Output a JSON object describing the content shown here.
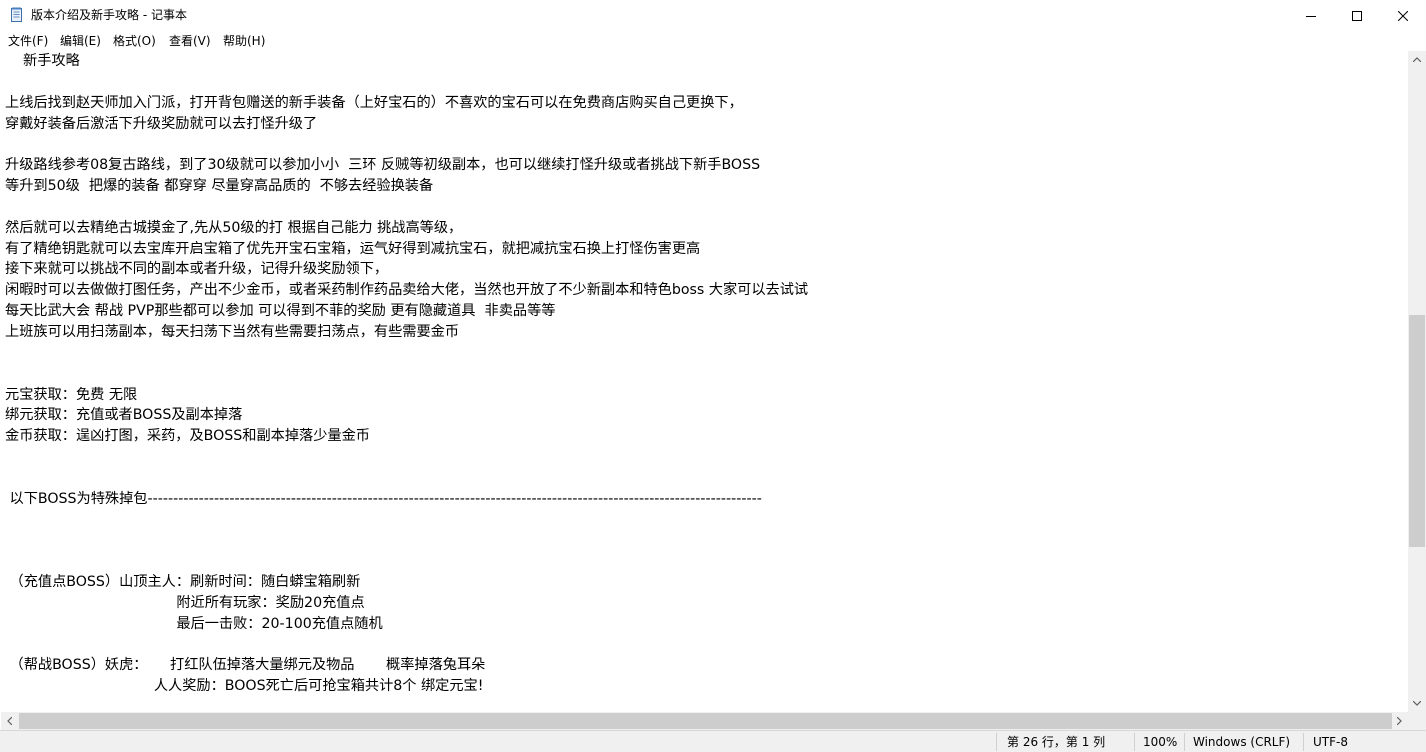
{
  "window": {
    "title": "版本介绍及新手攻略 - 记事本",
    "icon": "notepad-icon"
  },
  "menu": [
    {
      "label": "文件(F)"
    },
    {
      "label": "编辑(E)"
    },
    {
      "label": "格式(O)"
    },
    {
      "label": "查看(V)"
    },
    {
      "label": "帮助(H)"
    }
  ],
  "document": {
    "lines": [
      "    新手攻略",
      "",
      "上线后找到赵天师加入门派，打开背包赠送的新手装备（上好宝石的）不喜欢的宝石可以在免费商店购买自己更换下，",
      "穿戴好装备后激活下升级奖励就可以去打怪升级了",
      "",
      "升级路线参考08复古路线，到了30级就可以参加小小  三环 反贼等初级副本，也可以继续打怪升级或者挑战下新手BOSS",
      "等升到50级  把爆的装备 都穿穿 尽量穿高品质的  不够去经验换装备",
      "",
      "然后就可以去精绝古城摸金了,先从50级的打 根据自己能力 挑战高等级，",
      "有了精绝钥匙就可以去宝库开启宝箱了优先开宝石宝箱，运气好得到减抗宝石，就把减抗宝石换上打怪伤害更高",
      "接下来就可以挑战不同的副本或者升级，记得升级奖励领下，",
      "闲暇时可以去做做打图任务，产出不少金币，或者采药制作药品卖给大佬，当然也开放了不少新副本和特色boss 大家可以去试试",
      "每天比武大会 帮战 PVP那些都可以参加 可以得到不菲的奖励 更有隐藏道具  非卖品等等",
      "上班族可以用扫荡副本，每天扫荡下当然有些需要扫荡点，有些需要金币",
      "",
      "",
      "元宝获取：免费 无限",
      "绑元获取：充值或者BOSS及副本掉落",
      "金币获取：逞凶打图，采药，及BOSS和副本掉落少量金币",
      "",
      "",
      " 以下BOSS为特殊掉包------------------------------------------------------------------------------------------------------------------------",
      "",
      "",
      "",
      " （充值点BOSS）山顶主人：刷新时间：随白蟒宝箱刷新",
      "                                      附近所有玩家：奖励20充值点",
      "                                      最后一击败：20-100充值点随机",
      "",
      " （帮战BOSS）妖虎：     打红队伍掉落大量绑元及物品       概率掉落兔耳朵",
      "                                 人人奖励：BOOS死亡后可抢宝箱共计8个 绑定元宝!"
    ]
  },
  "status": {
    "position": "第 26 行，第 1 列",
    "zoom": "100%",
    "line_ending": "Windows (CRLF)",
    "encoding": "UTF-8"
  }
}
